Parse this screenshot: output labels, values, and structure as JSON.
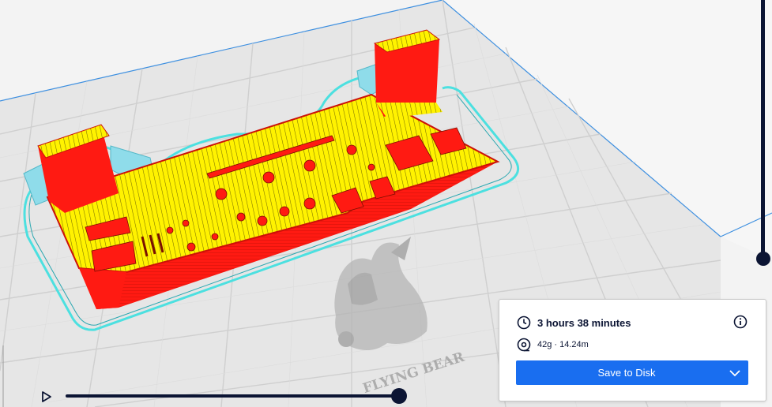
{
  "print_info": {
    "print_time": "3 hours 38 minutes",
    "material_usage": "42g · 14.24m",
    "save_button_label": "Save to Disk"
  },
  "watermark": {
    "brand_text": "FLYING BEAR"
  },
  "icons": {
    "play": "play-icon",
    "clock": "clock-icon",
    "spool": "spool-icon",
    "info": "info-icon",
    "chevron": "chevron-down-icon"
  },
  "colors": {
    "model_wall": "#ff1a12",
    "model_infill": "#fff200",
    "skirt": "#4ce0e0",
    "support": "#7fd6e8",
    "accent": "#196ef0",
    "dark": "#0b1433"
  }
}
